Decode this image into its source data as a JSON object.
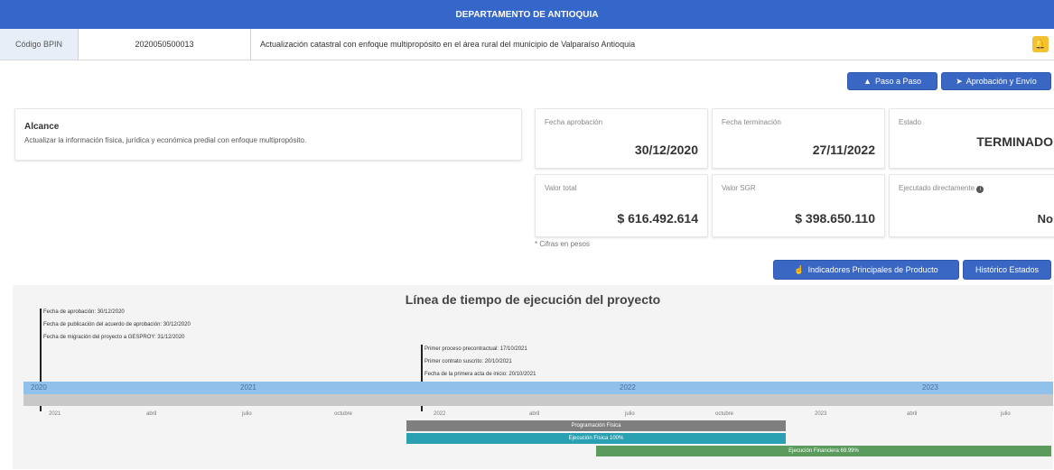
{
  "header": {
    "department": "DEPARTAMENTO DE ANTIOQUIA"
  },
  "project": {
    "code_label": "Código BPIN",
    "code_value": "2020050500013",
    "title": "Actualización catastral con enfoque multipropósito en el área rural del municipio de Valparaíso Antioquia"
  },
  "actions": {
    "step_button": "Paso a Paso",
    "approval_button": "Aprobación y Envío",
    "indicators_button": "Indicadores Principales de Producto",
    "history_button": "Histórico Estados"
  },
  "scope": {
    "title": "Alcance",
    "text": "Actualizar la información física, jurídica y económica predial con enfoque multipropósito."
  },
  "cards": [
    {
      "label": "Fecha aprobación",
      "value": "30/12/2020"
    },
    {
      "label": "Fecha terminación",
      "value": "27/11/2022"
    },
    {
      "label": "Estado",
      "value": "TERMINADO"
    },
    {
      "label": "Valor total",
      "value": "$ 616.492.614"
    },
    {
      "label": "Valor SGR",
      "value": "$ 398.650.110"
    },
    {
      "label": "Ejecutado directamente",
      "value": "No"
    }
  ],
  "note": "* Cifras en pesos",
  "timeline": {
    "title": "Línea de tiempo de ejecución del proyecto",
    "annotations_left": [
      "Fecha de aprobación: 30/12/2020",
      "Fecha de publicación del acuerdo de aprobación: 30/12/2020",
      "Fecha de migración del proyecto a GESPROY: 31/12/2020"
    ],
    "annotations_mid": [
      "Primer proceso precontractual: 17/10/2021",
      "Primer contrato suscrito: 20/10/2021",
      "Fecha de la primera acta de inicio: 20/10/2021"
    ],
    "years": [
      "2020",
      "2021",
      "2022",
      "2023"
    ],
    "ticks": [
      "2021",
      "abril",
      "julio",
      "octubre",
      "2022",
      "abril",
      "julio",
      "octubre",
      "2023",
      "abril",
      "julio"
    ],
    "bars": [
      {
        "label": "Programación Física",
        "color": "#7f7f7f"
      },
      {
        "label": "Ejecución Física 100%",
        "color": "#2aa1b3"
      },
      {
        "label": "Ejecución Financiera 69.99%",
        "color": "#5b9b5e"
      }
    ]
  }
}
